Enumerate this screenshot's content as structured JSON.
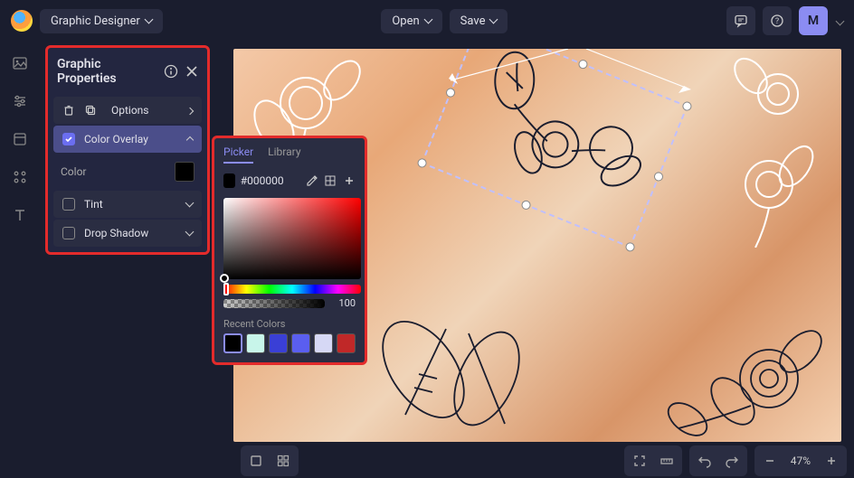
{
  "header": {
    "app_name": "Graphic Designer",
    "open_label": "Open",
    "save_label": "Save",
    "user_initial": "M"
  },
  "sidebar": {
    "items": [
      "image",
      "adjust",
      "window",
      "apps",
      "text"
    ]
  },
  "properties": {
    "title": "Graphic Properties",
    "options_label": "Options",
    "sections": [
      {
        "label": "Color Overlay",
        "checked": true,
        "expanded": true
      },
      {
        "label": "Tint",
        "checked": false,
        "expanded": false
      },
      {
        "label": "Drop Shadow",
        "checked": false,
        "expanded": false
      }
    ],
    "color_label": "Color",
    "color_value": "#000000"
  },
  "color_picker": {
    "tabs": {
      "picker": "Picker",
      "library": "Library"
    },
    "active_tab": "picker",
    "hex": "#000000",
    "alpha": "100",
    "recent_label": "Recent Colors",
    "recent": [
      "#000000",
      "#c8f5ea",
      "#3a3fd6",
      "#5a5ef0",
      "#d6d8f5",
      "#c02828"
    ]
  },
  "bottom": {
    "zoom": "47%"
  }
}
